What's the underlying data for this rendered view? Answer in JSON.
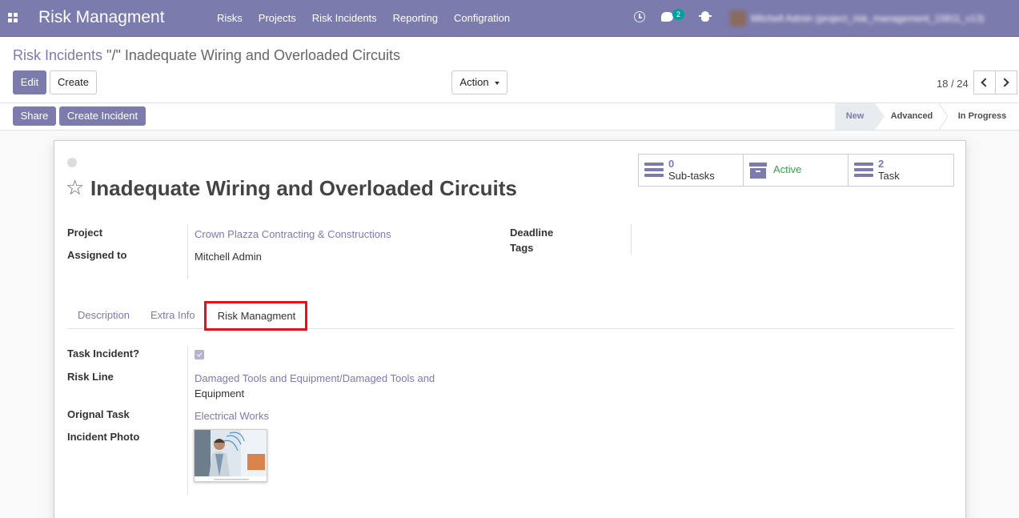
{
  "app": {
    "title": "Risk Managment"
  },
  "menu": [
    "Risks",
    "Projects",
    "Risk Incidents",
    "Reporting",
    "Configration"
  ],
  "systray": {
    "chat_count": "2",
    "user_name": "Mitchell Admin (project_risk_management_15811_v13)"
  },
  "breadcrumb": {
    "parent": "Risk Incidents",
    "separator": " \"/\" ",
    "current": "Inadequate Wiring and Overloaded Circuits"
  },
  "buttons": {
    "edit": "Edit",
    "create": "Create",
    "action": "Action",
    "share": "Share",
    "create_incident": "Create Incident"
  },
  "pager": {
    "value": "18 / 24"
  },
  "stages": [
    {
      "label": "New",
      "active": true
    },
    {
      "label": "Advanced",
      "active": false
    },
    {
      "label": "In Progress",
      "active": false
    }
  ],
  "record": {
    "title": "Inadequate Wiring and Overloaded Circuits",
    "smart_buttons": [
      {
        "value": "0",
        "label": "Sub-tasks"
      },
      {
        "status": "Active"
      },
      {
        "value": "2",
        "label": "Task"
      }
    ],
    "fields": {
      "project_label": "Project",
      "project_value": "Crown Plazza Contracting & Constructions",
      "assigned_label": "Assigned to",
      "assigned_value": "Mitchell Admin",
      "deadline_label": "Deadline",
      "tags_label": "Tags"
    },
    "tabs": [
      "Description",
      "Extra Info",
      "Risk Managment"
    ],
    "risk": {
      "task_incident_label": "Task Incident?",
      "task_incident_checked": true,
      "risk_line_label": "Risk Line",
      "risk_line_value_1": "Damaged Tools and Equipment/Damaged Tools and",
      "risk_line_value_2": "Equipment",
      "orig_task_label": "Orignal Task",
      "orig_task_value": "Electrical Works",
      "photo_label": "Incident Photo"
    }
  },
  "colors": {
    "brand": "#7c7bad",
    "active_status": "#28a745",
    "highlight": "#e8101a"
  }
}
